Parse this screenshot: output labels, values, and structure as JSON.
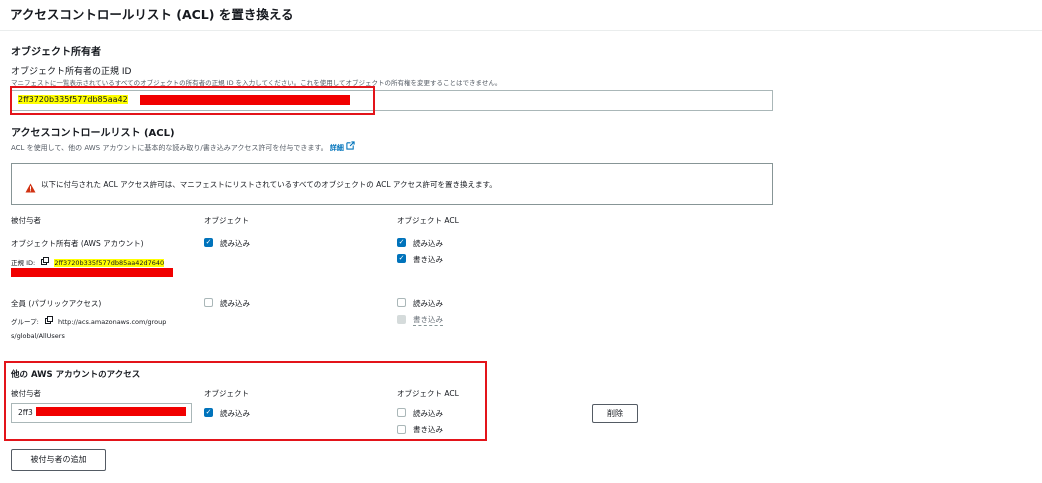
{
  "header": {
    "title": "アクセスコントロールリスト (ACL) を置き換える"
  },
  "owner": {
    "section_title": "オブジェクト所有者",
    "field_label": "オブジェクト所有者の正規 ID",
    "field_desc": "マニフェストに一覧表示されているすべてのオブジェクトの所有者の正規 ID を入力してください。これを使用してオブジェクトの所有権を変更することはできません。",
    "field_value": "2ff3720b335f577db85aa42"
  },
  "acl": {
    "section_title": "アクセスコントロールリスト (ACL)",
    "desc": "ACL を使用して、他の AWS アカウントに基本的な読み取り/書き込みアクセス許可を付与できます。",
    "info_link": "詳細",
    "warning": "以下に付与された ACL アクセス許可は、マニフェストにリストされているすべてのオブジェクトの ACL アクセス許可を置き換えます。",
    "col_grantee": "被付与者",
    "col_object": "オブジェクト",
    "col_object_acl": "オブジェクト ACL",
    "read": "読み込み",
    "write": "書き込み",
    "owner_row": {
      "name": "オブジェクト所有者 (AWS アカウント)",
      "id_label": "正規 ID:",
      "id_value": "2ff3720b335f577db85aa42d7640"
    },
    "public_row": {
      "name": "全員 (パブリックアクセス)",
      "group_label": "グループ:",
      "group_value_1": "http://acs.amazonaws.com/group",
      "group_value_2": "s/global/AllUsers"
    }
  },
  "other": {
    "section_title": "他の AWS アカウントのアクセス",
    "grantee_value": "2ff3",
    "remove_label": "削除",
    "add_label": "被付与者の追加"
  }
}
